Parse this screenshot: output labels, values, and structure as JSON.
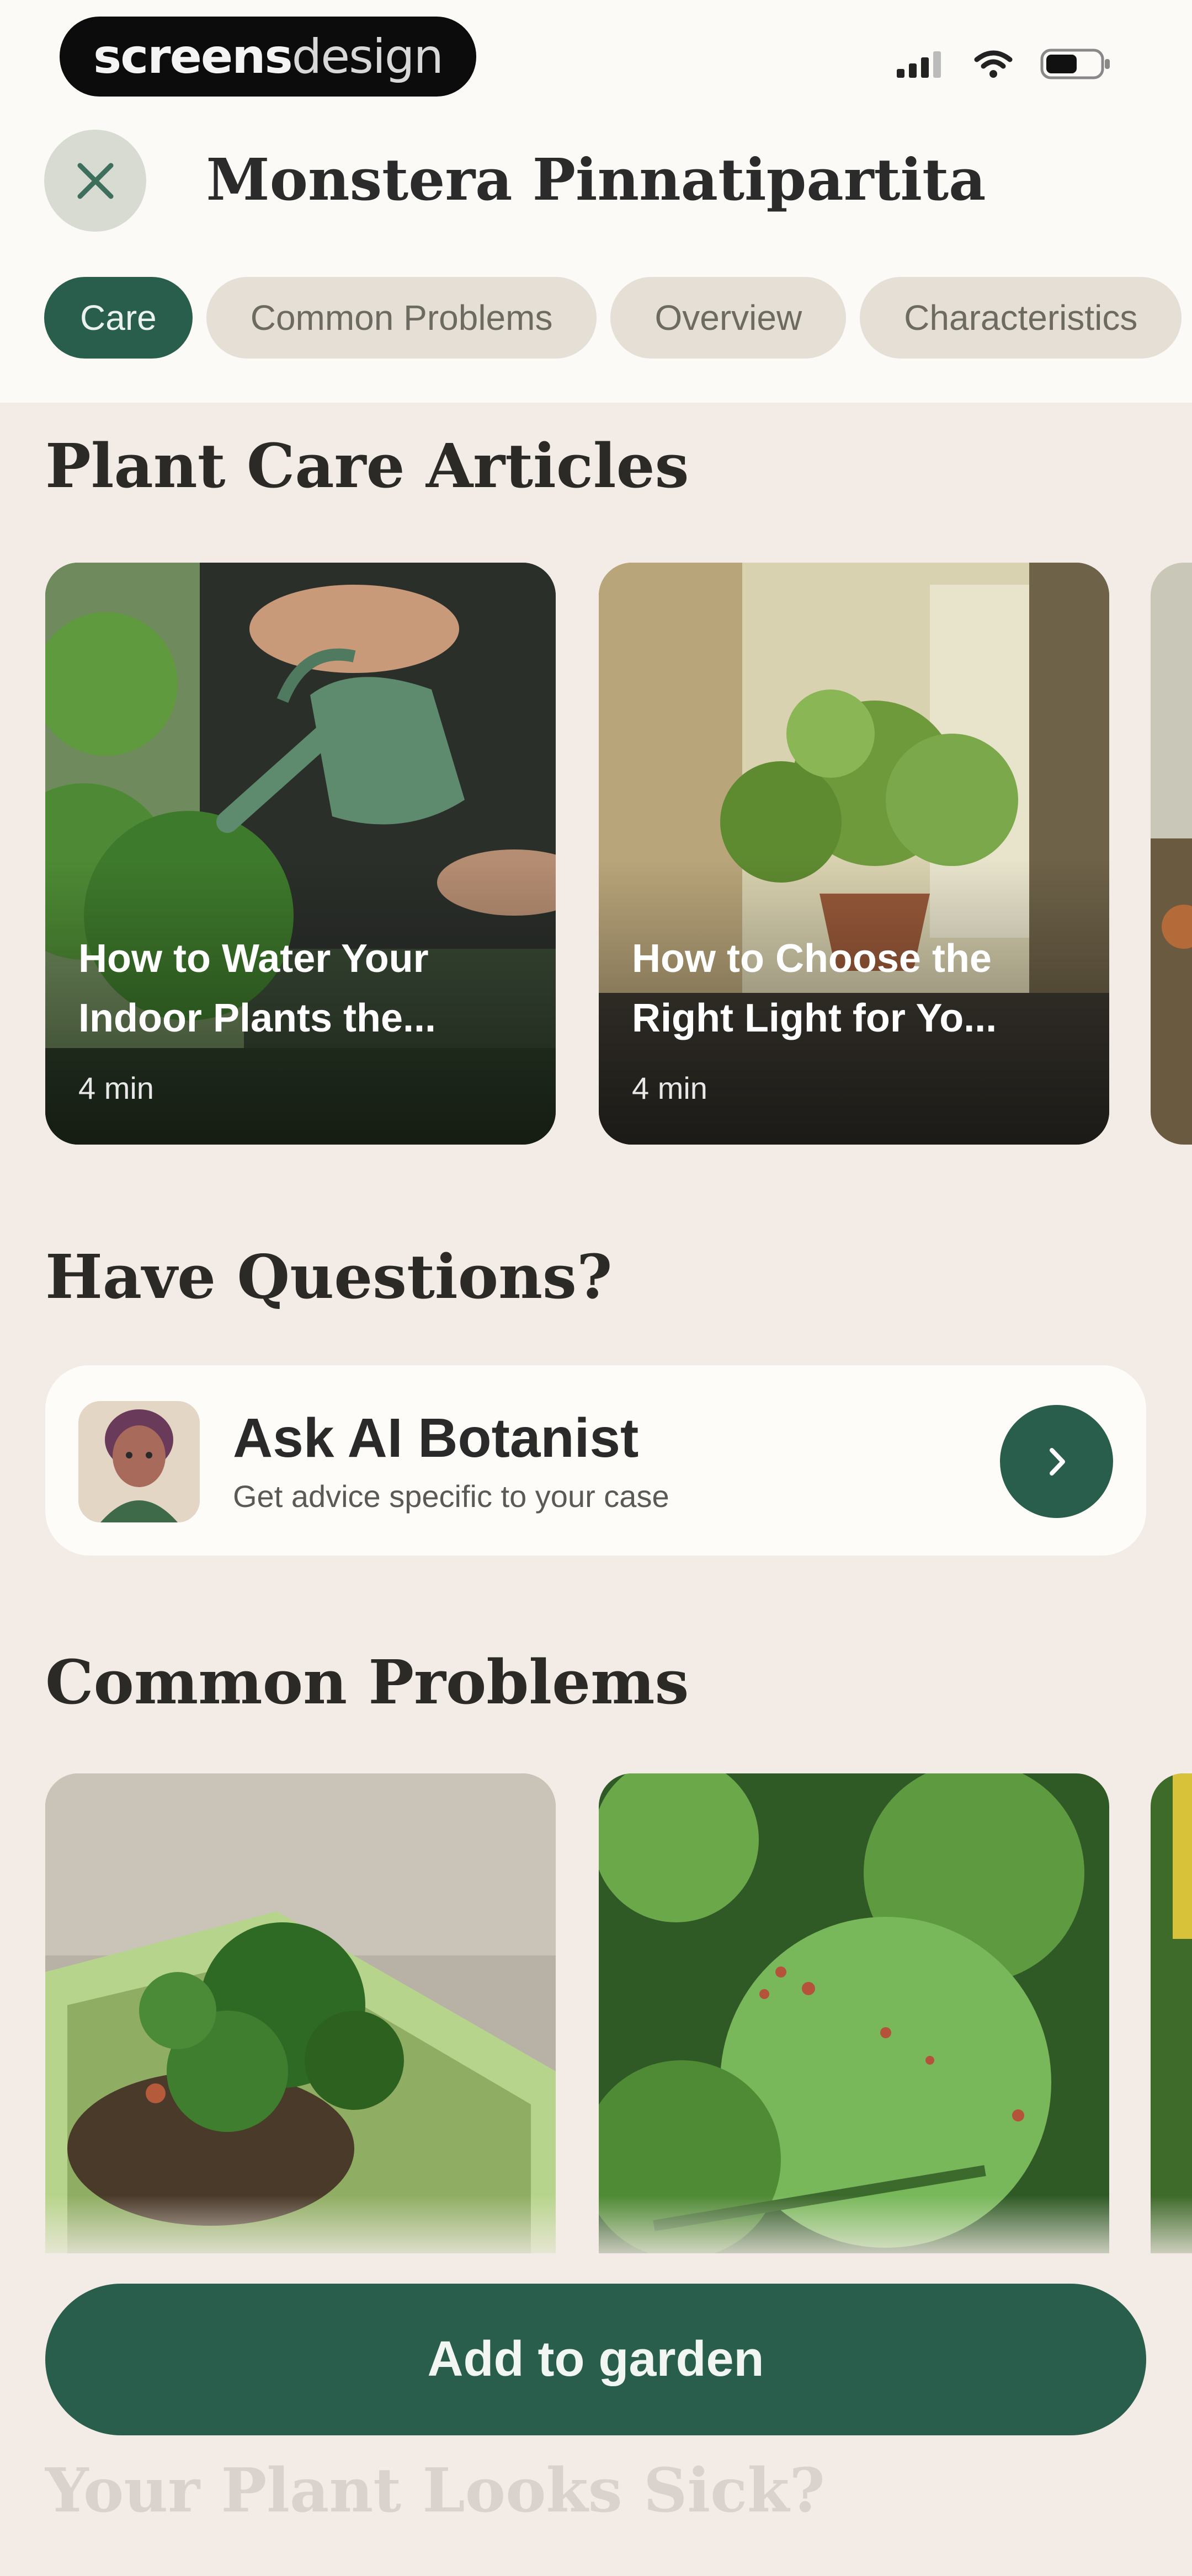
{
  "watermark": {
    "brand_bold": "screens",
    "brand_light": "design"
  },
  "header": {
    "title": "Monstera Pinnatipartita"
  },
  "tabs": [
    {
      "label": "Care",
      "active": true
    },
    {
      "label": "Common Problems",
      "active": false
    },
    {
      "label": "Overview",
      "active": false
    },
    {
      "label": "Characteristics",
      "active": false
    }
  ],
  "articles": {
    "heading": "Plant Care Articles",
    "items": [
      {
        "title": "How to Water Your Indoor Plants the...",
        "meta": "4 min",
        "image": "watering-can-plants-photo"
      },
      {
        "title": "How to Choose the Right Light for Yo...",
        "meta": "4 min",
        "image": "pothos-window-photo"
      }
    ]
  },
  "questions": {
    "heading": "Have Questions?",
    "ask_title": "Ask AI Botanist",
    "ask_subtitle": "Get advice specific to your case"
  },
  "problems": {
    "heading": "Common Problems",
    "items": [
      {
        "image": "seedling-planter-photo"
      },
      {
        "image": "spotted-leaves-photo"
      }
    ]
  },
  "cta": {
    "label": "Add to garden"
  },
  "next_section": {
    "heading": "Your Plant Looks Sick?"
  },
  "colors": {
    "accent": "#285e4b",
    "background": "#f3ebe5",
    "header_bg": "#fbfaf7",
    "tab_inactive": "#e5dfd5"
  }
}
